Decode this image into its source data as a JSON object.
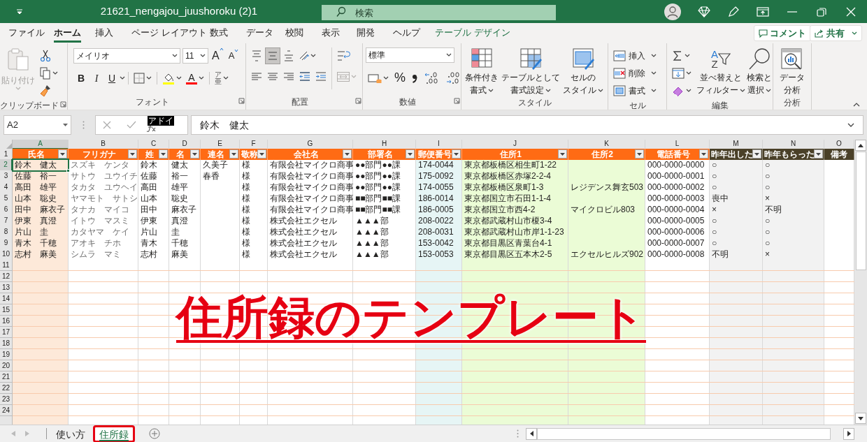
{
  "window": {
    "title": "21621_nengajou_juushoroku (2)1",
    "search": {
      "placeholder": "検索"
    }
  },
  "ribbon_tabs": [
    {
      "label": "ファイル",
      "selected": false,
      "kind": "normal"
    },
    {
      "label": "ホーム",
      "selected": true,
      "kind": "normal"
    },
    {
      "label": "挿入",
      "selected": false,
      "kind": "normal"
    },
    {
      "label": "ページ レイアウト",
      "selected": false,
      "kind": "normal"
    },
    {
      "label": "数式",
      "selected": false,
      "kind": "normal"
    },
    {
      "label": "データ",
      "selected": false,
      "kind": "normal"
    },
    {
      "label": "校閲",
      "selected": false,
      "kind": "normal"
    },
    {
      "label": "表示",
      "selected": false,
      "kind": "normal"
    },
    {
      "label": "開発",
      "selected": false,
      "kind": "normal"
    },
    {
      "label": "ヘルプ",
      "selected": false,
      "kind": "normal"
    },
    {
      "label": "テーブル デザイン",
      "selected": false,
      "kind": "contextual"
    }
  ],
  "actions": [
    "コメント",
    "共有"
  ],
  "ribbon": {
    "clipboard": {
      "label": "クリップボード",
      "paste": {
        "label": "貼り付け",
        "disabled": true
      }
    },
    "font": {
      "label": "フォント",
      "name": "メイリオ",
      "size": "11",
      "grow": "A",
      "shrink": "A",
      "styles": [
        {
          "kind": "bold",
          "label": "B"
        },
        {
          "kind": "italic",
          "label": "I"
        },
        {
          "kind": "underline",
          "label": "U"
        }
      ],
      "font_color": "A",
      "phonetic": [
        "ア",
        "亜"
      ]
    },
    "alignment": {
      "label": "配置",
      "buttons": [
        {
          "kind": "top",
          "selected": false
        },
        {
          "kind": "middle",
          "selected": true
        },
        {
          "kind": "bottom",
          "selected": false
        },
        {
          "kind": "left",
          "selected": false
        },
        {
          "kind": "center",
          "selected": false
        },
        {
          "kind": "right",
          "selected": false
        },
        {
          "kind": "outdent",
          "selected": false
        },
        {
          "kind": "indent",
          "selected": false
        }
      ],
      "merge_disabled": true
    },
    "number": {
      "label": "数値",
      "format": "標準",
      "percent": "%"
    },
    "styles": {
      "label": "スタイル",
      "buttons": [
        [
          "条件付き",
          "書式"
        ],
        [
          "テーブルとして",
          "書式設定"
        ],
        [
          "セルの",
          "スタイル"
        ]
      ]
    },
    "cells": {
      "label": "セル",
      "buttons": [
        {
          "kind": "insert",
          "label": "挿入"
        },
        {
          "kind": "delete",
          "label": "削除"
        },
        {
          "kind": "format",
          "label": "書式"
        }
      ]
    },
    "editing": {
      "label": "編集",
      "sort": [
        "並べ替えと",
        "フィルター"
      ],
      "sort_glyphs": [
        "A",
        "Z"
      ],
      "find": [
        "検索と",
        "選択"
      ]
    },
    "analysis": {
      "label": "分析",
      "button": [
        "データ",
        "分析"
      ]
    }
  },
  "formula_bar": {
    "name_box": "A2",
    "addin_tip": "アドイ",
    "value": "鈴木　健太"
  },
  "sheet": {
    "header_row_number": "1",
    "columns": [
      {
        "letter": "A",
        "header": "氏名",
        "color": "#fde9d9",
        "kind": "orange",
        "filter": true
      },
      {
        "letter": "B",
        "header": "フリガナ",
        "color": "#ffffff",
        "kind": "orange",
        "filter": true
      },
      {
        "letter": "C",
        "header": "姓",
        "color": "#ffffff",
        "kind": "orange",
        "filter": true
      },
      {
        "letter": "D",
        "header": "名",
        "color": "#ffffff",
        "kind": "orange",
        "filter": true
      },
      {
        "letter": "E",
        "header": "連名",
        "color": "#ffffff",
        "kind": "orange",
        "filter": true
      },
      {
        "letter": "F",
        "header": "敬称",
        "color": "#ffffff",
        "kind": "orange",
        "filter": true
      },
      {
        "letter": "G",
        "header": "会社名",
        "color": "#ffffff",
        "kind": "orange",
        "filter": true
      },
      {
        "letter": "H",
        "header": "部署名",
        "color": "#ffffff",
        "kind": "orange",
        "filter": true
      },
      {
        "letter": "I",
        "header": "郵便番号",
        "color": "#e6f5f5",
        "kind": "orange",
        "filter": true
      },
      {
        "letter": "J",
        "header": "住所1",
        "color": "#ebfcd6",
        "kind": "orange",
        "filter": true
      },
      {
        "letter": "K",
        "header": "住所2",
        "color": "#ebfcd6",
        "kind": "orange",
        "filter": true
      },
      {
        "letter": "L",
        "header": "電話番号",
        "color": "#ffffff",
        "kind": "orange",
        "filter": true
      },
      {
        "letter": "M",
        "header": "昨年出した",
        "color": "#f2f2f2",
        "kind": "dark",
        "filter": true
      },
      {
        "letter": "N",
        "header": "昨年もらった",
        "color": "#f2f2f2",
        "kind": "dark",
        "filter": true
      },
      {
        "letter": "O",
        "header": "備考",
        "color": "#ffffff",
        "kind": "dark",
        "filter": false
      }
    ],
    "rows": [
      {
        "number": "2",
        "selected": true,
        "cells": [
          "鈴木　健太",
          "スズキ　ケンタ",
          "鈴木",
          "健太",
          "久美子",
          "様",
          "有限会社マイクロ商事",
          "●●部門●●課",
          "174-0044",
          "東京都板橋区相生町1-22",
          null,
          "000-0000-0000",
          "○",
          "○",
          null
        ]
      },
      {
        "number": "3",
        "selected": false,
        "cells": [
          "佐藤　裕一",
          "サトウ　ユウイチ",
          "佐藤",
          "裕一",
          "春香",
          "様",
          "有限会社マイクロ商事",
          "●●部門●●課",
          "175-0092",
          "東京都板橋区赤塚2-2-4",
          null,
          "000-0000-0001",
          "○",
          "○",
          null
        ]
      },
      {
        "number": "4",
        "selected": false,
        "cells": [
          "高田　雄平",
          "タカタ　ユウヘイ",
          "高田",
          "雄平",
          null,
          "様",
          "有限会社マイクロ商事",
          "●●部門●●課",
          "174-0055",
          "東京都板橋区泉町1-3",
          "レジデンス舞玄503",
          "000-0000-0002",
          "○",
          "○",
          null
        ]
      },
      {
        "number": "5",
        "selected": false,
        "cells": [
          "山本　聡史",
          "ヤマモト　サトシ",
          "山本",
          "聡史",
          null,
          "様",
          "有限会社マイクロ商事",
          "■■部門■■課",
          "186-0014",
          "東京都国立市石田1-1-4",
          null,
          "000-0000-0003",
          "喪中",
          "×",
          null
        ]
      },
      {
        "number": "6",
        "selected": false,
        "cells": [
          "田中　麻衣子",
          "タナカ　マイコ",
          "田中",
          "麻衣子",
          null,
          "様",
          "有限会社マイクロ商事",
          "■■部門■■課",
          "186-0005",
          "東京都国立市西4-2",
          "マイクロビル803",
          "000-0000-0004",
          "×",
          "不明",
          null
        ]
      },
      {
        "number": "7",
        "selected": false,
        "cells": [
          "伊東　真澄",
          "イトウ　マスミ",
          "伊東",
          "真澄",
          null,
          "様",
          "株式会社エクセル",
          "▲▲▲部",
          "208-0022",
          "東京都武蔵村山市榎3-4",
          null,
          "000-0000-0005",
          "○",
          "○",
          null
        ]
      },
      {
        "number": "8",
        "selected": false,
        "cells": [
          "片山　圭",
          "カタヤマ　ケイ",
          "片山",
          "圭",
          null,
          "様",
          "株式会社エクセル",
          "▲▲▲部",
          "208-0031",
          "東京都武蔵村山市岸1-1-23",
          null,
          "000-0000-0006",
          "○",
          "○",
          null
        ]
      },
      {
        "number": "9",
        "selected": false,
        "cells": [
          "青木　千穂",
          "アオキ　チホ",
          "青木",
          "千穂",
          null,
          "様",
          "株式会社エクセル",
          "▲▲▲部",
          "153-0042",
          "東京都目黒区青葉台4-1",
          null,
          "000-0000-0007",
          "○",
          "○",
          null
        ]
      },
      {
        "number": "10",
        "selected": false,
        "cells": [
          "志村　麻美",
          "シムラ　マミ",
          "志村",
          "麻美",
          null,
          "様",
          "株式会社エクセル",
          "▲▲▲部",
          "153-0053",
          "東京都目黒区五本木2-5",
          "エクセルヒルズ902",
          "000-0000-0008",
          "不明",
          "×",
          null
        ]
      }
    ],
    "empty_rows": [
      "11",
      "12",
      "13",
      "14",
      "15",
      "16",
      "17",
      "18",
      "19",
      "20",
      "21",
      "22",
      "23",
      "24"
    ]
  },
  "overlay_caption": "住所録のテンプレート",
  "sheet_tabs": [
    {
      "label": "使い方",
      "selected": false,
      "highlighted": false
    },
    {
      "label": "住所録",
      "selected": true,
      "highlighted": true
    }
  ]
}
